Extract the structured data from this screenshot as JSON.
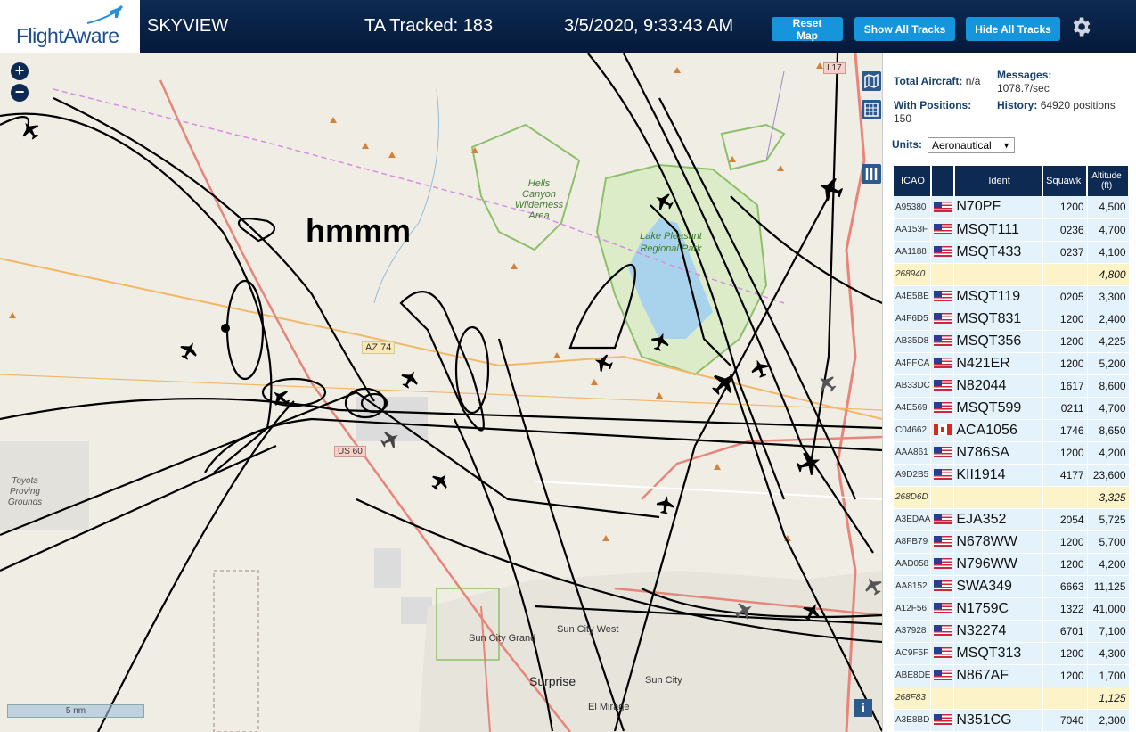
{
  "header": {
    "logo": "FlightAware",
    "app_name": "SKYVIEW",
    "tracked": "TA Tracked: 183",
    "datetime": "3/5/2020, 9:33:43 AM",
    "reset_label": "Reset Map",
    "show_all_label": "Show All Tracks",
    "hide_all_label": "Hide All Tracks",
    "settings_icon": "gear-icon"
  },
  "map": {
    "annotation": "hmmm",
    "scale_label": "5 nm",
    "labels": {
      "hells_canyon": "Hells Canyon Wilderness Area",
      "lake_pleasant": "Lake Pleasant Regional Park",
      "toyota": "Toyota Proving Grounds",
      "az74": "AZ 74",
      "us60": "US 60",
      "i17": "I 17",
      "sun_city_grand": "Sun City Grand",
      "sun_city_west": "Sun City West",
      "surprise": "Surprise",
      "sun_city": "Sun City",
      "el_mirage": "El Mirage"
    },
    "colors": {
      "land": "#f0ede5",
      "water": "#a9d3ec",
      "park": "#d8ecc8",
      "track": "#000000",
      "highway": "#e8857a",
      "road": "#f2b866"
    }
  },
  "sidebar": {
    "total_aircraft_label": "Total Aircraft:",
    "total_aircraft_value": "n/a",
    "messages_label": "Messages:",
    "messages_value": "1078.7/sec",
    "positions_label": "With Positions:",
    "positions_value": "150",
    "history_label": "History:",
    "history_value": "64920 positions",
    "units_label": "Units:",
    "units_value": "Aeronautical",
    "columns": {
      "icao": "ICAO",
      "ident": "Ident",
      "squawk": "Squawk",
      "altitude": "Altitude (ft)"
    },
    "rows": [
      {
        "icao": "A95380",
        "flag": "us",
        "ident": "N70PF",
        "squawk": "1200",
        "alt": "4,500"
      },
      {
        "icao": "AA153F",
        "flag": "us",
        "ident": "MSQT111",
        "squawk": "0236",
        "alt": "4,700"
      },
      {
        "icao": "AA1188",
        "flag": "us",
        "ident": "MSQT433",
        "squawk": "0237",
        "alt": "4,100"
      },
      {
        "icao": "268940",
        "flag": "",
        "ident": "",
        "squawk": "",
        "alt": "4,800"
      },
      {
        "icao": "A4E5BE",
        "flag": "us",
        "ident": "MSQT119",
        "squawk": "0205",
        "alt": "3,300"
      },
      {
        "icao": "A4F6D5",
        "flag": "us",
        "ident": "MSQT831",
        "squawk": "1200",
        "alt": "2,400"
      },
      {
        "icao": "AB35D8",
        "flag": "us",
        "ident": "MSQT356",
        "squawk": "1200",
        "alt": "4,225"
      },
      {
        "icao": "A4FFCA",
        "flag": "us",
        "ident": "N421ER",
        "squawk": "1200",
        "alt": "5,200"
      },
      {
        "icao": "AB33DC",
        "flag": "us",
        "ident": "N82044",
        "squawk": "1617",
        "alt": "8,600"
      },
      {
        "icao": "A4E569",
        "flag": "us",
        "ident": "MSQT599",
        "squawk": "0211",
        "alt": "4,700"
      },
      {
        "icao": "C04662",
        "flag": "ca",
        "ident": "ACA1056",
        "squawk": "1746",
        "alt": "8,650"
      },
      {
        "icao": "AAA861",
        "flag": "us",
        "ident": "N786SA",
        "squawk": "1200",
        "alt": "4,200"
      },
      {
        "icao": "A9D2B5",
        "flag": "us",
        "ident": "KII1914",
        "squawk": "4177",
        "alt": "23,600"
      },
      {
        "icao": "268D6D",
        "flag": "",
        "ident": "",
        "squawk": "",
        "alt": "3,325"
      },
      {
        "icao": "A3EDAA",
        "flag": "us",
        "ident": "EJA352",
        "squawk": "2054",
        "alt": "5,725"
      },
      {
        "icao": "A8FB79",
        "flag": "us",
        "ident": "N678WW",
        "squawk": "1200",
        "alt": "5,700"
      },
      {
        "icao": "AAD058",
        "flag": "us",
        "ident": "N796WW",
        "squawk": "1200",
        "alt": "4,200"
      },
      {
        "icao": "AA8152",
        "flag": "us",
        "ident": "SWA349",
        "squawk": "6663",
        "alt": "11,125"
      },
      {
        "icao": "A12F56",
        "flag": "us",
        "ident": "N1759C",
        "squawk": "1322",
        "alt": "41,000"
      },
      {
        "icao": "A37928",
        "flag": "us",
        "ident": "N32274",
        "squawk": "6701",
        "alt": "7,100"
      },
      {
        "icao": "AC9F5F",
        "flag": "us",
        "ident": "MSQT313",
        "squawk": "1200",
        "alt": "4,300"
      },
      {
        "icao": "ABE8DE",
        "flag": "us",
        "ident": "N867AF",
        "squawk": "1200",
        "alt": "1,700"
      },
      {
        "icao": "268F83",
        "flag": "",
        "ident": "",
        "squawk": "",
        "alt": "1,125"
      },
      {
        "icao": "A3E8BD",
        "flag": "us",
        "ident": "N351CG",
        "squawk": "7040",
        "alt": "2,300"
      }
    ]
  }
}
